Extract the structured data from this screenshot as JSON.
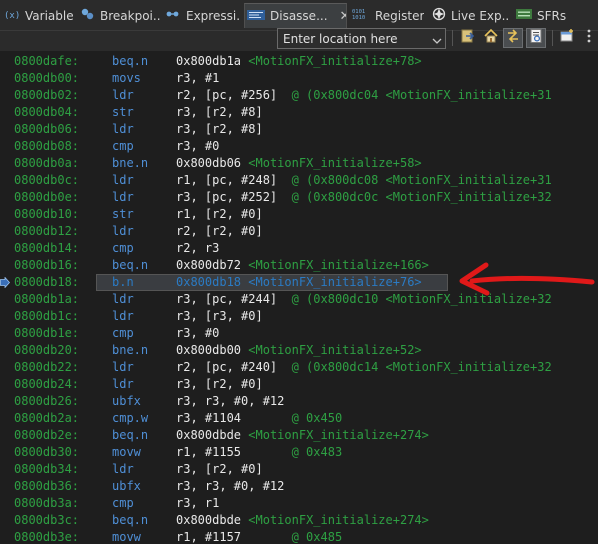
{
  "tabs": [
    {
      "label": "Variables",
      "icon": "variables-icon"
    },
    {
      "label": "Breakpoi...",
      "icon": "breakpoints-icon"
    },
    {
      "label": "Expressi...",
      "icon": "expressions-icon"
    },
    {
      "label": "Disasse...",
      "icon": "disassembly-icon",
      "active": true
    },
    {
      "label": "Registers",
      "icon": "registers-icon"
    },
    {
      "label": "Live Exp...",
      "icon": "live-expressions-icon"
    },
    {
      "label": "SFRs",
      "icon": "sfrs-icon"
    }
  ],
  "toolbar": {
    "location_placeholder": "Enter location here",
    "buttons": [
      "go-to-location-icon",
      "home-icon",
      "link-with-editor-icon",
      "show-source-icon",
      "new-view-icon",
      "view-menu-icon"
    ]
  },
  "disassembly": {
    "current_row_index": 13,
    "rows": [
      {
        "addr": "0800dafe:",
        "mnem": "beq.n",
        "ops": "0x800db1a",
        "sym": "<MotionFX_initialize+78>",
        "cmt": ""
      },
      {
        "addr": "0800db00:",
        "mnem": "movs",
        "ops": "r3, #1",
        "sym": "",
        "cmt": ""
      },
      {
        "addr": "0800db02:",
        "mnem": "ldr",
        "ops": "r2, [pc, #256]",
        "sym": "",
        "cmt": "  @ (0x800dc04 <MotionFX_initialize+31"
      },
      {
        "addr": "0800db04:",
        "mnem": "str",
        "ops": "r3, [r2, #8]",
        "sym": "",
        "cmt": ""
      },
      {
        "addr": "0800db06:",
        "mnem": "ldr",
        "ops": "r3, [r2, #8]",
        "sym": "",
        "cmt": ""
      },
      {
        "addr": "0800db08:",
        "mnem": "cmp",
        "ops": "r3, #0",
        "sym": "",
        "cmt": ""
      },
      {
        "addr": "0800db0a:",
        "mnem": "bne.n",
        "ops": "0x800db06",
        "sym": "<MotionFX_initialize+58>",
        "cmt": ""
      },
      {
        "addr": "0800db0c:",
        "mnem": "ldr",
        "ops": "r1, [pc, #248]",
        "sym": "",
        "cmt": "  @ (0x800dc08 <MotionFX_initialize+31"
      },
      {
        "addr": "0800db0e:",
        "mnem": "ldr",
        "ops": "r3, [pc, #252]",
        "sym": "",
        "cmt": "  @ (0x800dc0c <MotionFX_initialize+32"
      },
      {
        "addr": "0800db10:",
        "mnem": "str",
        "ops": "r1, [r2, #0]",
        "sym": "",
        "cmt": ""
      },
      {
        "addr": "0800db12:",
        "mnem": "ldr",
        "ops": "r2, [r2, #0]",
        "sym": "",
        "cmt": ""
      },
      {
        "addr": "0800db14:",
        "mnem": "cmp",
        "ops": "r2, r3",
        "sym": "",
        "cmt": ""
      },
      {
        "addr": "0800db16:",
        "mnem": "beq.n",
        "ops": "0x800db72",
        "sym": "<MotionFX_initialize+166>",
        "cmt": ""
      },
      {
        "addr": "0800db18:",
        "mnem": "b.n",
        "ops": "0x800db18",
        "sym": "<MotionFX_initialize+76>",
        "cmt": ""
      },
      {
        "addr": "0800db1a:",
        "mnem": "ldr",
        "ops": "r3, [pc, #244]",
        "sym": "",
        "cmt": "  @ (0x800dc10 <MotionFX_initialize+32"
      },
      {
        "addr": "0800db1c:",
        "mnem": "ldr",
        "ops": "r3, [r3, #0]",
        "sym": "",
        "cmt": ""
      },
      {
        "addr": "0800db1e:",
        "mnem": "cmp",
        "ops": "r3, #0",
        "sym": "",
        "cmt": ""
      },
      {
        "addr": "0800db20:",
        "mnem": "bne.n",
        "ops": "0x800db00",
        "sym": "<MotionFX_initialize+52>",
        "cmt": ""
      },
      {
        "addr": "0800db22:",
        "mnem": "ldr",
        "ops": "r2, [pc, #240]",
        "sym": "",
        "cmt": "  @ (0x800dc14 <MotionFX_initialize+32"
      },
      {
        "addr": "0800db24:",
        "mnem": "ldr",
        "ops": "r3, [r2, #0]",
        "sym": "",
        "cmt": ""
      },
      {
        "addr": "0800db26:",
        "mnem": "ubfx",
        "ops": "r3, r3, #0, #12",
        "sym": "",
        "cmt": ""
      },
      {
        "addr": "0800db2a:",
        "mnem": "cmp.w",
        "ops": "r3, #1104",
        "sym": "",
        "cmt": "       @ 0x450"
      },
      {
        "addr": "0800db2e:",
        "mnem": "beq.n",
        "ops": "0x800dbde",
        "sym": "<MotionFX_initialize+274>",
        "cmt": ""
      },
      {
        "addr": "0800db30:",
        "mnem": "movw",
        "ops": "r1, #1155",
        "sym": "",
        "cmt": "       @ 0x483"
      },
      {
        "addr": "0800db34:",
        "mnem": "ldr",
        "ops": "r3, [r2, #0]",
        "sym": "",
        "cmt": ""
      },
      {
        "addr": "0800db36:",
        "mnem": "ubfx",
        "ops": "r3, r3, #0, #12",
        "sym": "",
        "cmt": ""
      },
      {
        "addr": "0800db3a:",
        "mnem": "cmp",
        "ops": "r3, r1",
        "sym": "",
        "cmt": ""
      },
      {
        "addr": "0800db3c:",
        "mnem": "beq.n",
        "ops": "0x800dbde",
        "sym": "<MotionFX_initialize+274>",
        "cmt": ""
      },
      {
        "addr": "0800db3e:",
        "mnem": "movw",
        "ops": "r1, #1157",
        "sym": "",
        "cmt": "       @ 0x485"
      }
    ]
  },
  "colors": {
    "address": "#2ea043",
    "mnemonic": "#4f8fd6",
    "operands": "#e8e8e8",
    "arrow": "#e01919"
  }
}
